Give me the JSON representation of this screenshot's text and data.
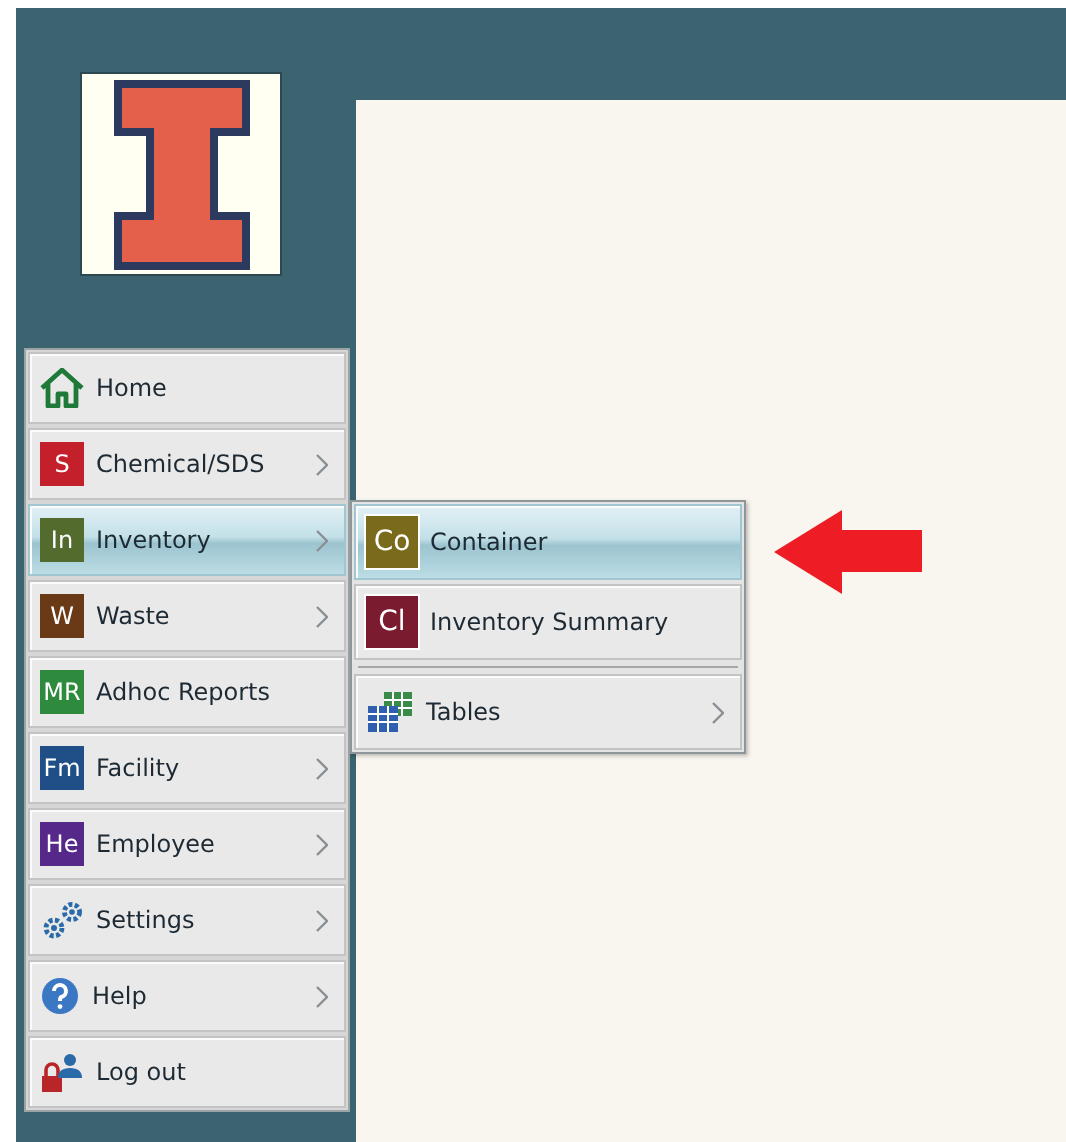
{
  "menu": {
    "items": [
      {
        "label": "Home",
        "kind": "home",
        "submenu": false,
        "selected": false
      },
      {
        "label": "Chemical/SDS",
        "kind": "badge",
        "badge": "S",
        "color": "#c4202c",
        "submenu": true,
        "selected": false
      },
      {
        "label": "Inventory",
        "kind": "badge",
        "badge": "In",
        "color": "#536b2c",
        "submenu": true,
        "selected": true
      },
      {
        "label": "Waste",
        "kind": "badge",
        "badge": "W",
        "color": "#6a3a16",
        "submenu": true,
        "selected": false
      },
      {
        "label": "Adhoc Reports",
        "kind": "badge",
        "badge": "MR",
        "color": "#2e8a3c",
        "submenu": false,
        "selected": false
      },
      {
        "label": "Facility",
        "kind": "badge",
        "badge": "Fm",
        "color": "#1f4f86",
        "submenu": true,
        "selected": false
      },
      {
        "label": "Employee",
        "kind": "badge",
        "badge": "He",
        "color": "#55288a",
        "submenu": true,
        "selected": false
      },
      {
        "label": "Settings",
        "kind": "settings",
        "submenu": true,
        "selected": false
      },
      {
        "label": "Help",
        "kind": "help",
        "submenu": true,
        "selected": false
      },
      {
        "label": "Log out",
        "kind": "logout",
        "submenu": false,
        "selected": false
      }
    ]
  },
  "submenu": {
    "items": [
      {
        "label": "Container",
        "kind": "badge",
        "badge": "Co",
        "color": "#7a6a1c",
        "submenu": false,
        "selected": true
      },
      {
        "label": "Inventory Summary",
        "kind": "badge",
        "badge": "Cl",
        "color": "#7a1b30",
        "submenu": false,
        "selected": false
      },
      {
        "kind": "separator"
      },
      {
        "label": "Tables",
        "kind": "tables",
        "submenu": true,
        "selected": false
      }
    ]
  }
}
